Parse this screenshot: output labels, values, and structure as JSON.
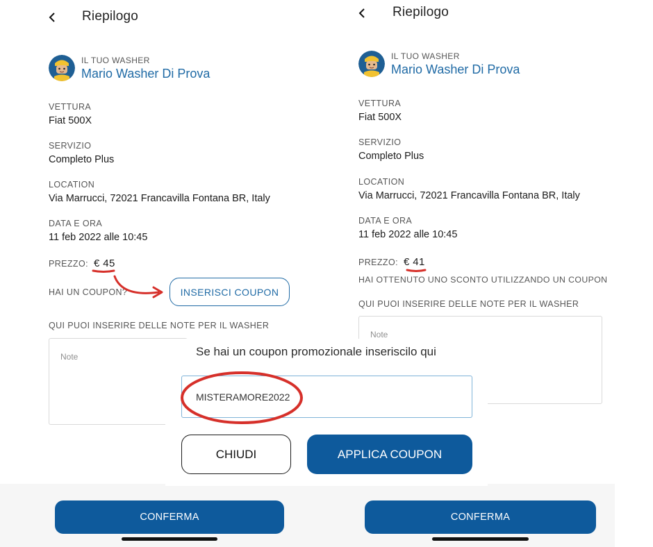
{
  "accent_color": "#1f6aa5",
  "annotation_color": "#d6302a",
  "left": {
    "title": "Riepilogo",
    "back_icon": "chevron-left-icon",
    "washer_label": "IL TUO WASHER",
    "washer_name": "Mario Washer Di Prova",
    "vehicle_label": "VETTURA",
    "vehicle_value": "Fiat 500X",
    "service_label": "SERVIZIO",
    "service_value": "Completo Plus",
    "location_label": "LOCATION",
    "location_value": "Via Marrucci, 72021 Francavilla Fontana BR, Italy",
    "datetime_label": "DATA E ORA",
    "datetime_value": "11 feb 2022 alle 10:45",
    "price_label": "PREZZO:",
    "price_value": "€ 45",
    "coupon_question": "HAI UN COUPON?",
    "coupon_button": "INSERISCI COUPON",
    "notes_label": "QUI PUOI INSERIRE DELLE NOTE PER IL WASHER",
    "notes_placeholder": "Note",
    "confirm_button": "CONFERMA"
  },
  "right": {
    "title": "Riepilogo",
    "back_icon": "chevron-left-icon",
    "washer_label": "IL TUO WASHER",
    "washer_name": "Mario Washer Di Prova",
    "vehicle_label": "VETTURA",
    "vehicle_value": "Fiat 500X",
    "service_label": "SERVIZIO",
    "service_value": "Completo Plus",
    "location_label": "LOCATION",
    "location_value": "Via Marrucci, 72021 Francavilla Fontana BR, Italy",
    "datetime_label": "DATA E ORA",
    "datetime_value": "11 feb 2022 alle 10:45",
    "price_label": "PREZZO:",
    "price_value": "€ 41",
    "discount_message": "HAI OTTENUTO UNO SCONTO UTILIZZANDO UN COUPON",
    "notes_label": "QUI PUOI INSERIRE DELLE NOTE PER IL WASHER",
    "notes_placeholder": "Note",
    "confirm_button": "CONFERMA"
  },
  "modal": {
    "title": "Se hai un coupon promozionale inseriscilo qui",
    "coupon_value": "MISTERAMORE2022",
    "close_button": "CHIUDI",
    "apply_button": "APPLICA COUPON"
  }
}
